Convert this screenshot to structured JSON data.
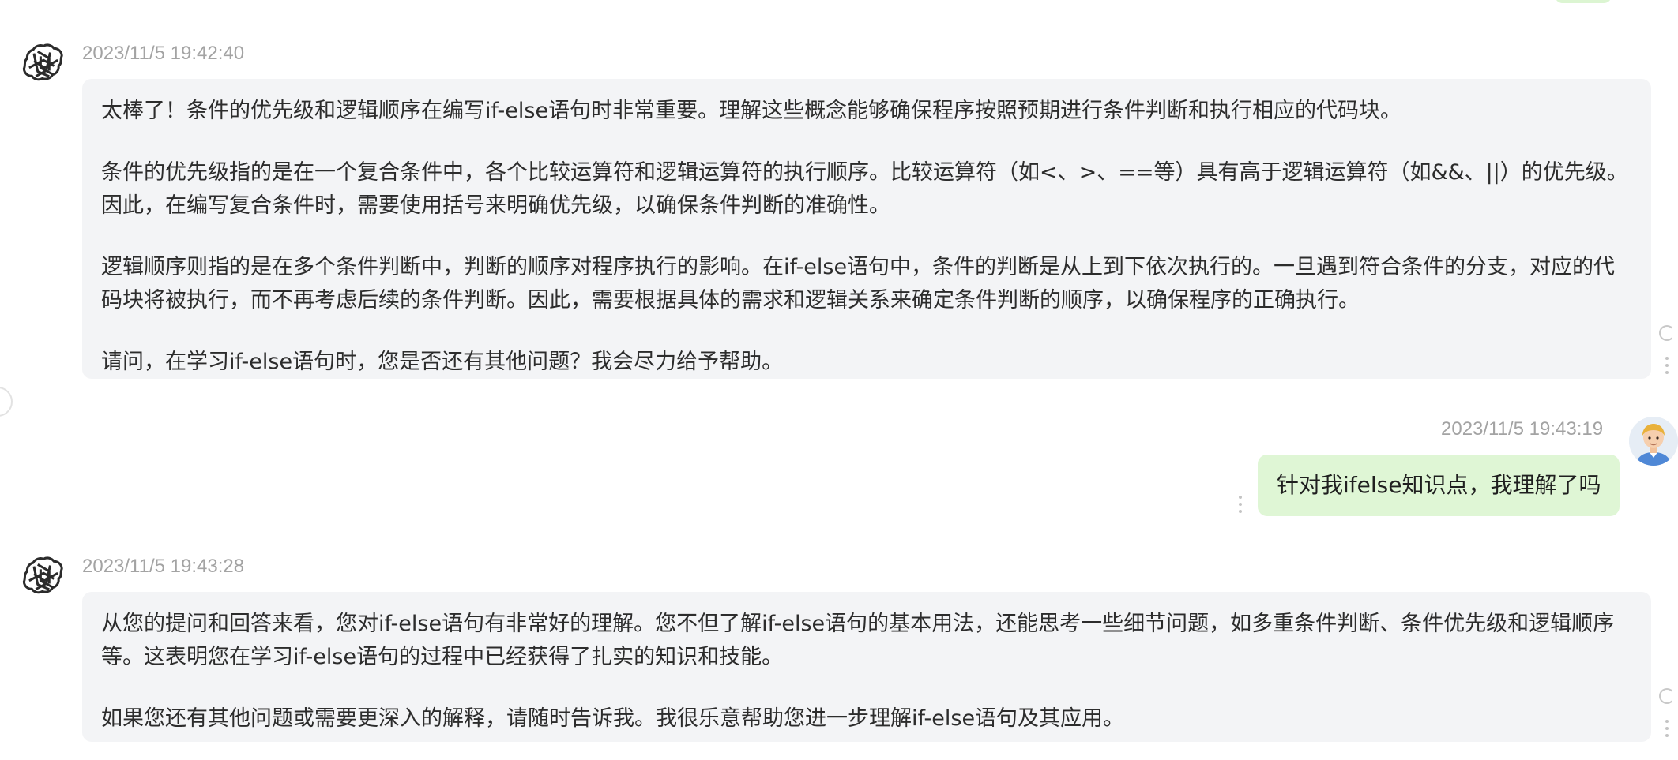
{
  "messages": [
    {
      "role": "assistant",
      "timestamp": "2023/11/5 19:42:40",
      "paragraphs": [
        "太棒了！条件的优先级和逻辑顺序在编写if-else语句时非常重要。理解这些概念能够确保程序按照预期进行条件判断和执行相应的代码块。",
        "条件的优先级指的是在一个复合条件中，各个比较运算符和逻辑运算符的执行顺序。比较运算符（如<、>、==等）具有高于逻辑运算符（如&&、||）的优先级。因此，在编写复合条件时，需要使用括号来明确优先级，以确保条件判断的准确性。",
        "逻辑顺序则指的是在多个条件判断中，判断的顺序对程序执行的影响。在if-else语句中，条件的判断是从上到下依次执行的。一旦遇到符合条件的分支，对应的代码块将被执行，而不再考虑后续的条件判断。因此，需要根据具体的需求和逻辑关系来确定条件判断的顺序，以确保程序的正确执行。",
        "请问，在学习if-else语句时，您是否还有其他问题？我会尽力给予帮助。"
      ]
    },
    {
      "role": "user",
      "timestamp": "2023/11/5 19:43:19",
      "text": "针对我ifelse知识点，我理解了吗"
    },
    {
      "role": "assistant",
      "timestamp": "2023/11/5 19:43:28",
      "paragraphs": [
        "从您的提问和回答来看，您对if-else语句有非常好的理解。您不但了解if-else语句的基本用法，还能思考一些细节问题，如多重条件判断、条件优先级和逻辑顺序等。这表明您在学习if-else语句的过程中已经获得了扎实的知识和技能。",
        "如果您还有其他问题或需要更深入的解释，请随时告诉我。我很乐意帮助您进一步理解if-else语句及其应用。"
      ]
    }
  ],
  "icons": {
    "assistant_avatar": "openai-logo-icon",
    "user_avatar": "user-avatar-icon",
    "regenerate": "refresh-icon",
    "more": "more-vertical-icon"
  },
  "colors": {
    "assistant_bubble": "#f3f4f6",
    "user_bubble": "#dff6d5",
    "timestamp": "#a3a3a3"
  }
}
